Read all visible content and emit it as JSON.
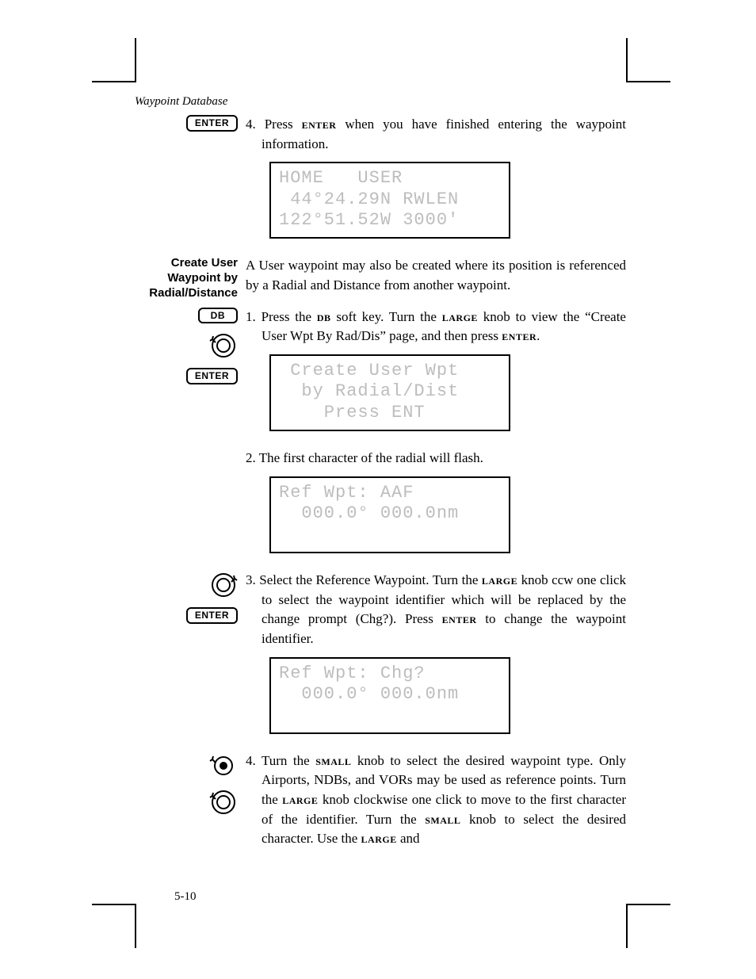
{
  "running_head": "Waypoint Database",
  "page_number": "5-10",
  "keys": {
    "enter": "ENTER",
    "db": "DB"
  },
  "side_heading": "Create User Waypoint by Radial/Distance",
  "para_top_prefix": "4. Press ",
  "para_top_suffix": " when you have finished entering the waypoint information.",
  "lcd1": {
    "l1": "HOME   USER",
    "l2": " 44°24.29N RWLEN",
    "l3": "122°51.52W 3000'"
  },
  "para_intro": "A User waypoint may also be created where its position is referenced by a Radial and Distance from another waypoint.",
  "step1_a": "1. Press the ",
  "step1_b": " soft key. Turn the ",
  "step1_c": " knob to view the “Create User Wpt By Rad/Dis” page, and then press ",
  "step1_d": ".",
  "lcd2": {
    "l1": " Create User Wpt",
    "l2": "  by Radial/Dist",
    "l3": "    Press ENT"
  },
  "step2": "2. The first character of the radial will flash.",
  "lcd3": {
    "l1": "Ref Wpt: AAF",
    "l2": "  000.0° 000.0nm",
    "l3": " "
  },
  "step3_a": "3. Select the Reference Waypoint. Turn the ",
  "step3_b": " knob ccw one click to select the waypoint identifier which will be replaced by the change prompt (Chg?). Press ",
  "step3_c": " to change the waypoint identifier.",
  "lcd4": {
    "l1": "Ref Wpt: Chg?",
    "l2": "  000.0° 000.0nm",
    "l3": " "
  },
  "step4_a": "4. Turn the ",
  "step4_b": " knob to select the desired waypoint type. Only Airports, NDBs, and VORs may be used as reference points. Turn the ",
  "step4_c": " knob clockwise one click to move to the first character of the identifier. Turn the ",
  "step4_d": " knob to select the desired character. Use the ",
  "step4_e": " and",
  "smallcaps": {
    "enter": "enter",
    "db": "db",
    "large": "large",
    "small": "small"
  }
}
